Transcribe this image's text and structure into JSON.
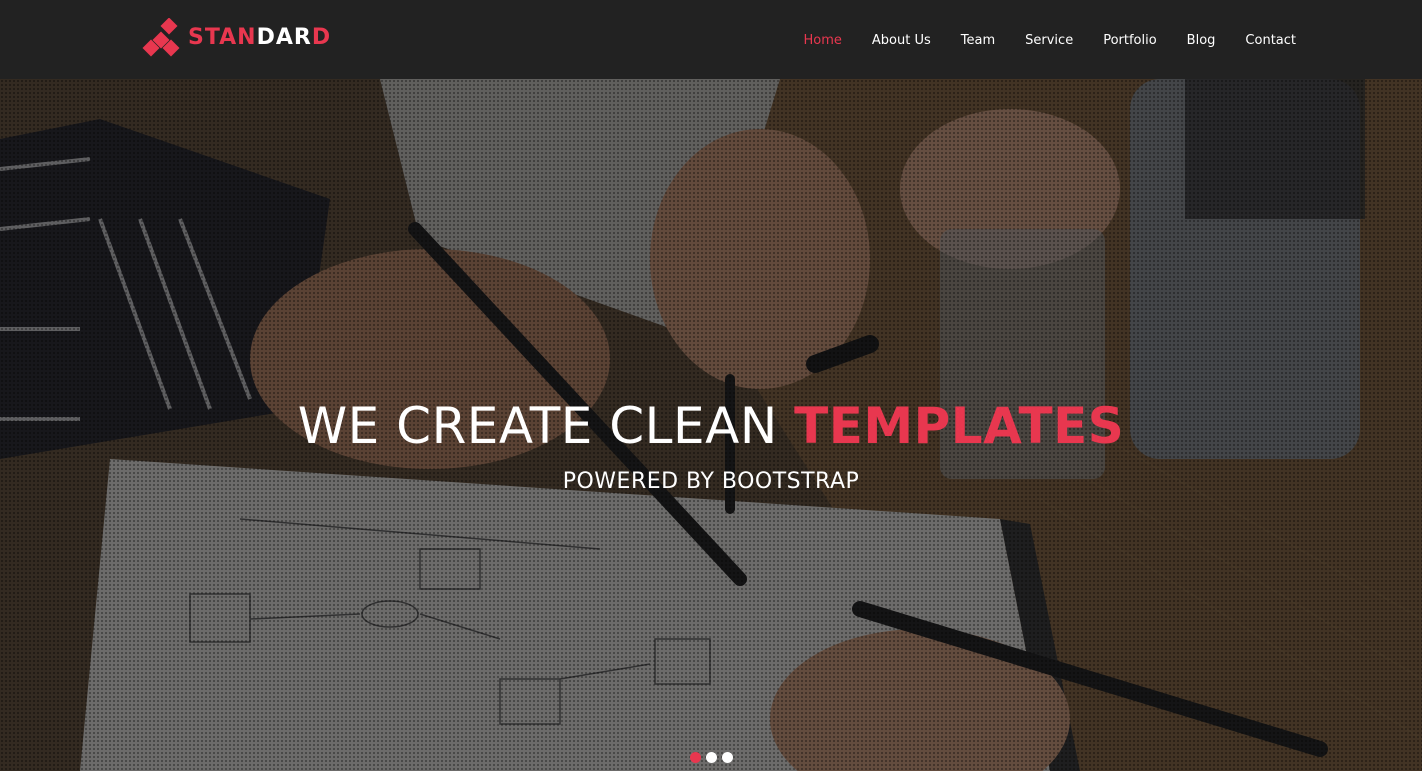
{
  "brand": {
    "logo_part1": "STAN",
    "logo_part2": "DAR",
    "logo_part3": "D",
    "accent_color": "#e8374f"
  },
  "nav": {
    "items": [
      {
        "label": "Home",
        "active": true
      },
      {
        "label": "About Us",
        "active": false
      },
      {
        "label": "Team",
        "active": false
      },
      {
        "label": "Service",
        "active": false
      },
      {
        "label": "Portfolio",
        "active": false
      },
      {
        "label": "Blog",
        "active": false
      },
      {
        "label": "Contact",
        "active": false
      }
    ]
  },
  "hero": {
    "title_main": "WE CREATE CLEAN ",
    "title_accent": "TEMPLATES",
    "subtitle": "POWERED BY BOOTSTRAP",
    "slides_total": 3,
    "active_slide": 1
  },
  "colors": {
    "navbar_bg": "#222222",
    "accent": "#e8374f",
    "text": "#ffffff"
  }
}
